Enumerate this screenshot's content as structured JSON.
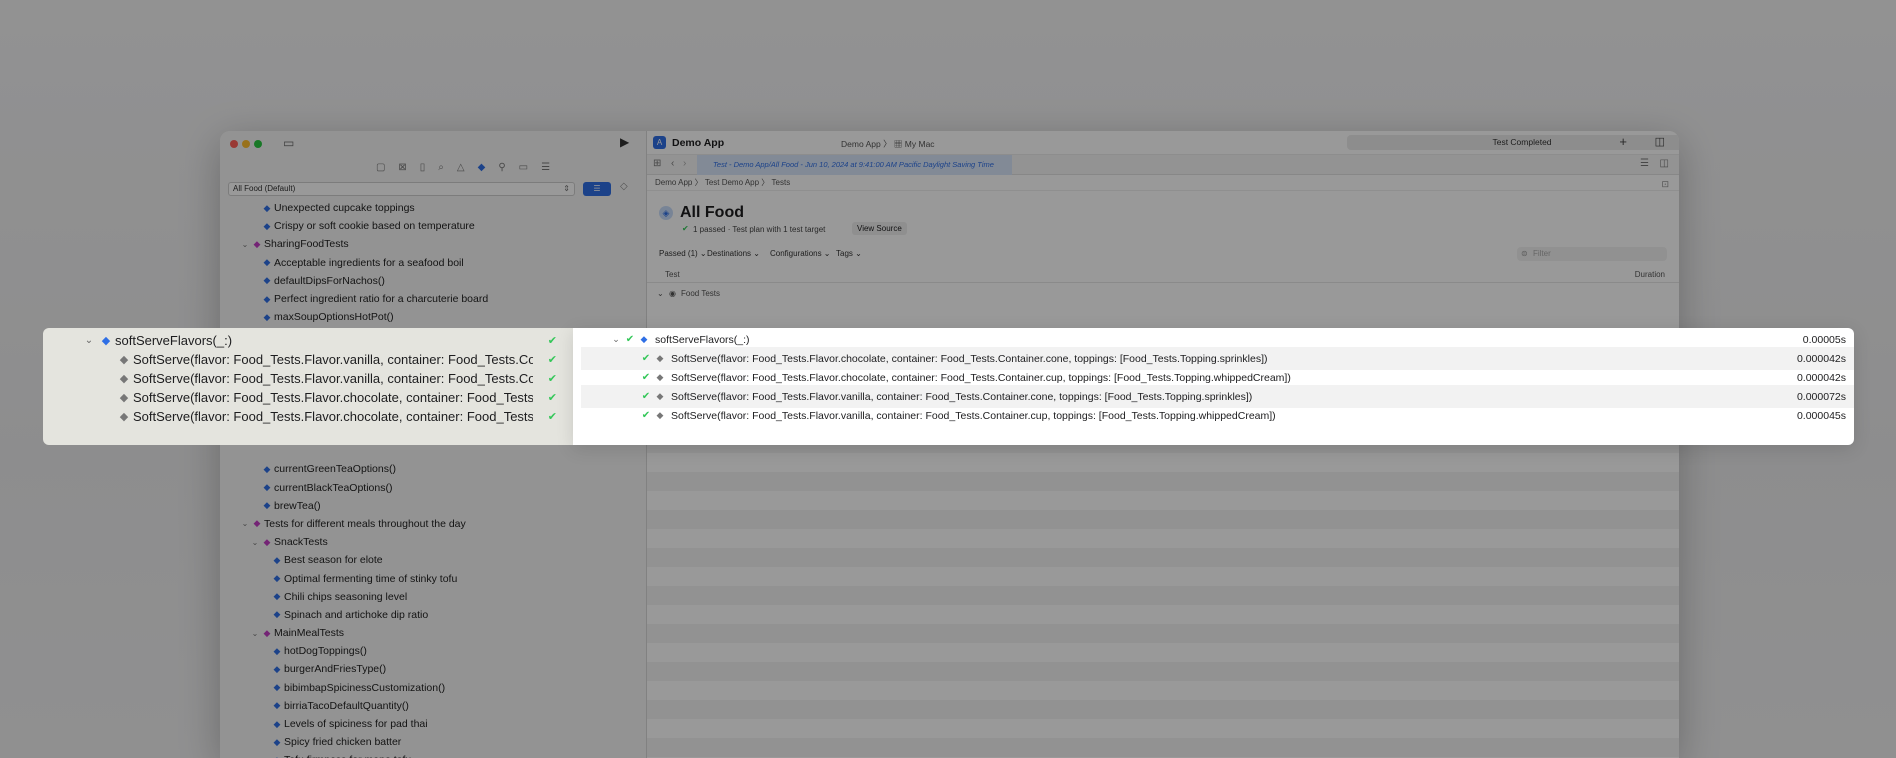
{
  "window": {
    "app_title": "Demo App",
    "scheme": "Demo App",
    "destination": "My Mac",
    "status": "Test Completed",
    "active_tab": "Test - Demo App/All Food - Jun 10, 2024 at 9:41:00 AM Pacific Daylight Saving Time"
  },
  "sidebar": {
    "test_plan": "All Food (Default)",
    "rows": [
      {
        "label": "Unexpected cupcake toppings",
        "kind": "test",
        "indent": 2
      },
      {
        "label": "Crispy or soft cookie based on temperature",
        "kind": "test",
        "indent": 2
      },
      {
        "label": "SharingFoodTests",
        "kind": "suite",
        "indent": 1
      },
      {
        "label": "Acceptable ingredients for a seafood boil",
        "kind": "test",
        "indent": 2
      },
      {
        "label": "defaultDipsForNachos()",
        "kind": "test",
        "indent": 2
      },
      {
        "label": "Perfect ingredient ratio for a charcuterie board",
        "kind": "test",
        "indent": 2
      },
      {
        "label": "maxSoupOptionsHotPot()",
        "kind": "test",
        "indent": 2
      }
    ],
    "rows_lower": [
      {
        "label": "currentGreenTeaOptions()",
        "kind": "test",
        "indent": 2
      },
      {
        "label": "currentBlackTeaOptions()",
        "kind": "test",
        "indent": 2
      },
      {
        "label": "brewTea()",
        "kind": "test",
        "indent": 2
      },
      {
        "label": "Tests for different meals throughout the day",
        "kind": "suite",
        "indent": 1
      },
      {
        "label": "SnackTests",
        "kind": "suite",
        "indent": 2
      },
      {
        "label": "Best season for elote",
        "kind": "test",
        "indent": 3
      },
      {
        "label": "Optimal fermenting time of stinky tofu",
        "kind": "test",
        "indent": 3
      },
      {
        "label": "Chili chips seasoning level",
        "kind": "test",
        "indent": 3
      },
      {
        "label": "Spinach and artichoke dip ratio",
        "kind": "test",
        "indent": 3
      },
      {
        "label": "MainMealTests",
        "kind": "suite",
        "indent": 2
      },
      {
        "label": "hotDogToppings()",
        "kind": "test",
        "indent": 3
      },
      {
        "label": "burgerAndFriesType()",
        "kind": "test",
        "indent": 3
      },
      {
        "label": "bibimbapSpicinessCustomization()",
        "kind": "test",
        "indent": 3
      },
      {
        "label": "birriaTacoDefaultQuantity()",
        "kind": "test",
        "indent": 3
      },
      {
        "label": "Levels of spiciness for pad thai",
        "kind": "test",
        "indent": 3
      },
      {
        "label": "Spicy fried chicken batter",
        "kind": "test",
        "indent": 3
      },
      {
        "label": "Tofu firmness for mapo tofu",
        "kind": "test",
        "indent": 3
      }
    ]
  },
  "report": {
    "breadcrumbs": [
      "Demo App",
      "Test Demo App",
      "Tests"
    ],
    "title": "All Food",
    "summary": "1 passed · Test plan with 1 test target",
    "view_source": "View Source",
    "filters": {
      "passed": "Passed (1) ⌄",
      "destinations": "Destinations ⌄",
      "configurations": "Configurations ⌄",
      "tags": "Tags ⌄"
    },
    "search_placeholder": "Filter",
    "col_test": "Test",
    "col_duration": "Duration",
    "group": "Food Tests"
  },
  "highlight": {
    "parent_label": "softServeFlavors(_:)",
    "parent_duration": "0.00005s",
    "left_rows": [
      "SoftServe(flavor: Food_Tests.Flavor.vanilla, container: Food_Tests.Container.cone, toppings: [Food_Tests.Topping.sprinkles])",
      "SoftServe(flavor: Food_Tests.Flavor.vanilla, container: Food_Tests.Container.cup, toppings: [Food_Tests.Topping.whippedCream])",
      "SoftServe(flavor: Food_Tests.Flavor.chocolate, container: Food_Tests.Container.cone, toppings: [Food_Tests.Topping.sprinkles])",
      "SoftServe(flavor: Food_Tests.Flavor.chocolate, container: Food_Tests.Container.cup, toppings: [Food_Tests.Topping.whippedCream])"
    ],
    "right_rows": [
      {
        "label": "SoftServe(flavor: Food_Tests.Flavor.chocolate, container: Food_Tests.Container.cone, toppings: [Food_Tests.Topping.sprinkles])",
        "duration": "0.000042s"
      },
      {
        "label": "SoftServe(flavor: Food_Tests.Flavor.chocolate, container: Food_Tests.Container.cup, toppings: [Food_Tests.Topping.whippedCream])",
        "duration": "0.000042s"
      },
      {
        "label": "SoftServe(flavor: Food_Tests.Flavor.vanilla, container: Food_Tests.Container.cone, toppings: [Food_Tests.Topping.sprinkles])",
        "duration": "0.000072s"
      },
      {
        "label": "SoftServe(flavor: Food_Tests.Flavor.vanilla, container: Food_Tests.Container.cup, toppings: [Food_Tests.Topping.whippedCream])",
        "duration": "0.000045s"
      }
    ]
  },
  "colors": {
    "accent": "#2f6fe5",
    "pass": "#34c759",
    "suite": "#c23cc4"
  }
}
